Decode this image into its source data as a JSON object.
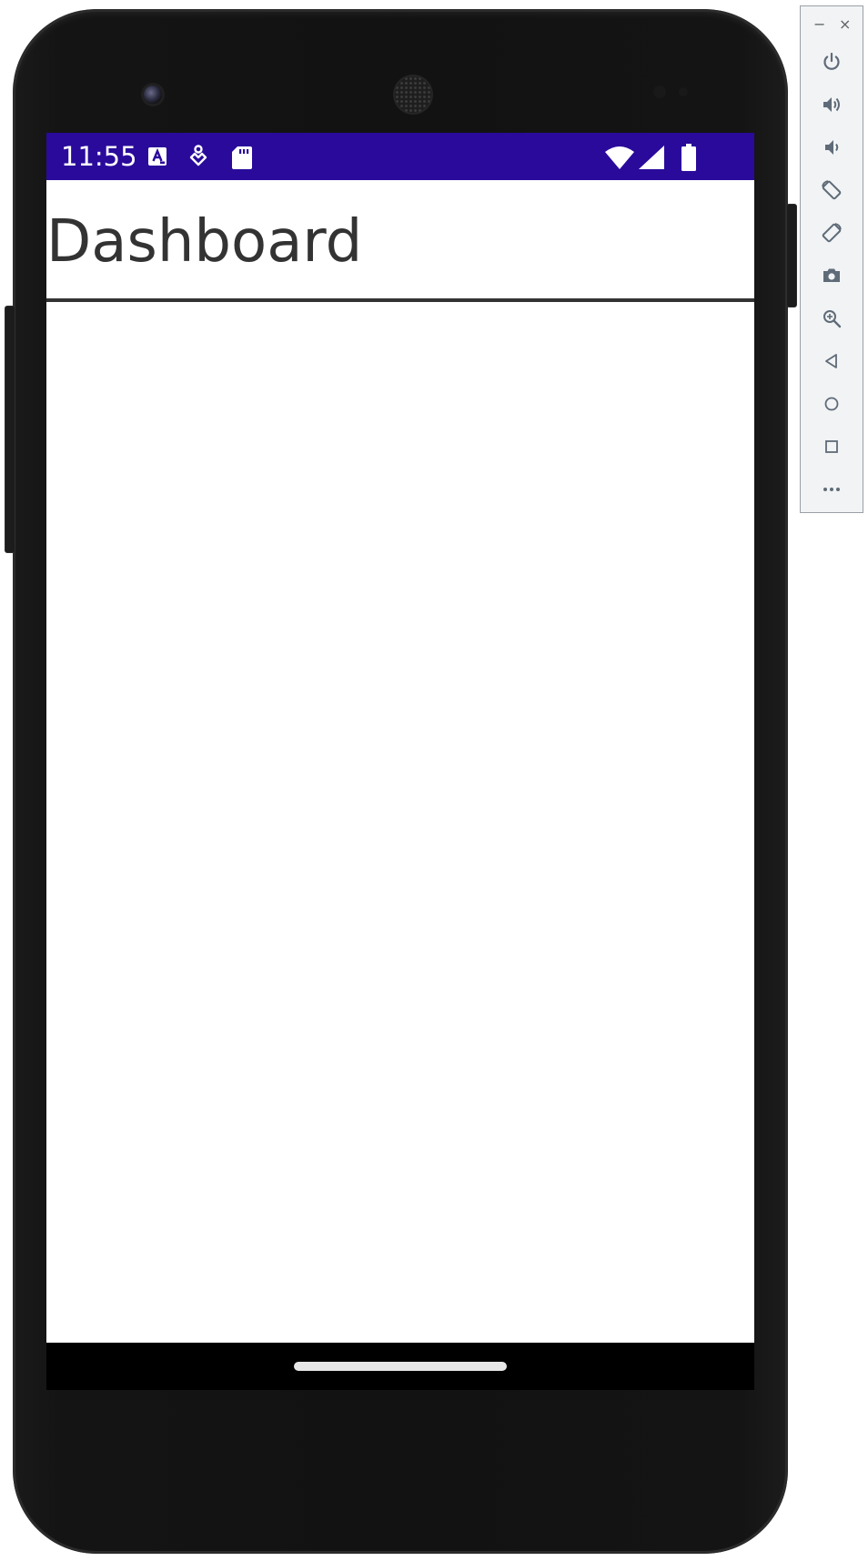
{
  "status_bar": {
    "time": "11:55",
    "icons": [
      "accessibility-a-icon",
      "tap-pointer-icon",
      "sd-card-icon",
      "wifi-icon",
      "cell-signal-icon",
      "battery-icon"
    ],
    "background_color": "#2a0a9b"
  },
  "app": {
    "title": "Dashboard",
    "title_color": "#333333"
  },
  "emulator_toolbar": {
    "window_controls": {
      "minimize": "−",
      "close": "×"
    },
    "buttons": [
      "power-icon",
      "volume-up-icon",
      "volume-down-icon",
      "rotate-left-icon",
      "rotate-right-icon",
      "camera-icon",
      "zoom-icon",
      "back-icon",
      "home-icon",
      "overview-icon",
      "more-icon"
    ],
    "icon_color": "#5f6b78"
  }
}
